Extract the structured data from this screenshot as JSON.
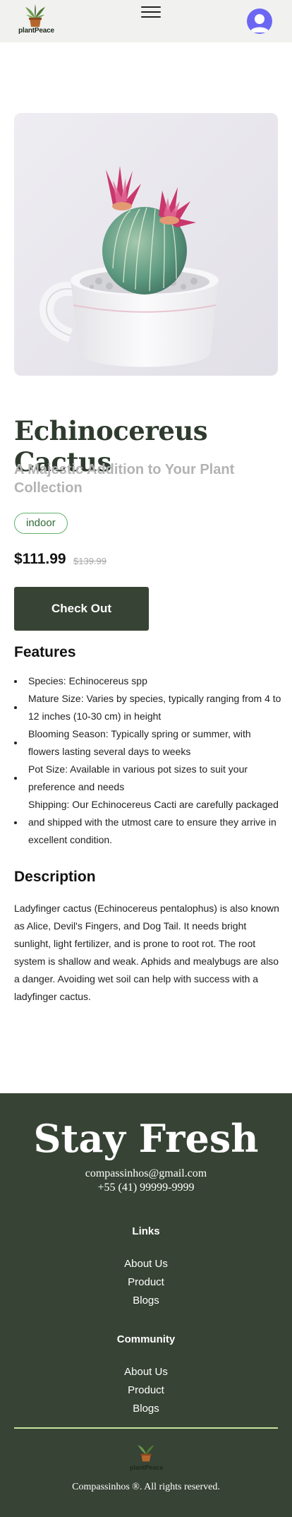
{
  "header": {
    "logo_text": "plantPeace",
    "menu_icon": "hamburger-menu-icon",
    "avatar_icon": "user-avatar-icon"
  },
  "product": {
    "image_icon": "cactus-photo",
    "title": "Echinocereus Cactus",
    "subtitle": "A Majestic Addition to Your Plant Collection",
    "tag": "indoor",
    "price": "$111.99",
    "old_price": "$139.99",
    "checkout_label": "Check Out"
  },
  "features": {
    "heading": "Features",
    "items": [
      "Species: Echinocereus spp",
      "Mature Size: Varies by species, typically ranging from 4 to 12 inches (10-30 cm) in height",
      "Blooming Season: Typically spring or summer, with flowers lasting several days to weeks",
      "Pot Size: Available in various pot sizes to suit your preference and needs",
      "Shipping: Our Echinocereus Cacti are carefully packaged and shipped with the utmost care to ensure they arrive in excellent condition."
    ]
  },
  "description": {
    "heading": "Description",
    "text": "Ladyfinger cactus (Echinocereus pentalophus) is also known as Alice, Devil's Fingers, and Dog Tail. It needs bright sunlight, light fertilizer, and is prone to root rot. The root system is shallow and weak. Aphids and mealybugs are also a danger. Avoiding wet soil can help with success with a ladyfinger cactus."
  },
  "footer": {
    "title": "Stay Fresh",
    "email": "compassinhos@gmail.com",
    "phone": "+55 (41) 99999-9999",
    "links_heading": "Links",
    "links": [
      "About Us",
      "Product",
      "Blogs"
    ],
    "community_heading": "Community",
    "community": [
      "About Us",
      "Product",
      "Blogs"
    ],
    "logo_text": "plantPeace",
    "copyright": "Compassinhos ®. All rights reserved."
  },
  "colors": {
    "primary": "#374334",
    "accent_green": "#61b36a",
    "divider": "#c7e59e",
    "avatar": "#6c67f2"
  }
}
